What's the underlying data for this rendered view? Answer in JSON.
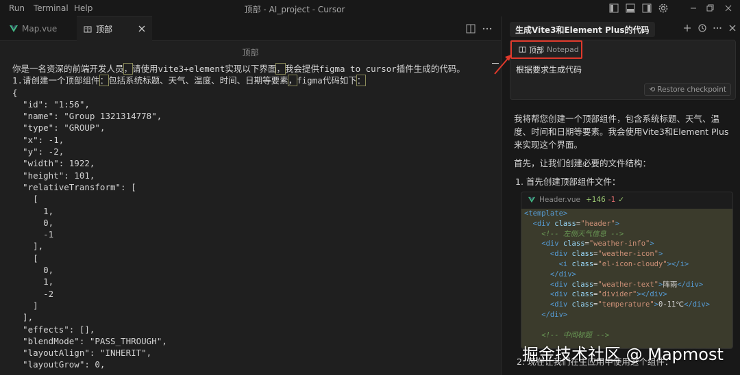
{
  "titlebar": {
    "menus": [
      "Run",
      "Terminal",
      "Help"
    ],
    "title": "顶部 - AI_project - Cursor"
  },
  "editor": {
    "tabs": [
      {
        "label": "Map.vue",
        "icon": "vue-icon",
        "active": false
      },
      {
        "label": "顶部",
        "icon": "notepad-icon",
        "active": true
      }
    ],
    "heading": "顶部",
    "lines": [
      "你是一名资深的前端开发人员，请使用vite3+element实现以下界面，我会提供figma to cursor插件生成的代码。",
      "1.请创建一个顶部组件：包括系统标题、天气、温度、时间、日期等要素，figma代码如下：",
      "{",
      "  \"id\": \"1:56\",",
      "  \"name\": \"Group 1321314778\",",
      "  \"type\": \"GROUP\",",
      "  \"x\": -1,",
      "  \"y\": -2,",
      "  \"width\": 1922,",
      "  \"height\": 101,",
      "  \"relativeTransform\": [",
      "    [",
      "      1,",
      "      0,",
      "      -1",
      "    ],",
      "    [",
      "      0,",
      "      1,",
      "      -2",
      "    ]",
      "  ],",
      "  \"effects\": [],",
      "  \"blendMode\": \"PASS_THROUGH\",",
      "  \"layoutAlign\": \"INHERIT\",",
      "  \"layoutGrow\": 0,"
    ]
  },
  "chat": {
    "title": "生成Vite3和Element Plus的代码",
    "chip_name": "顶部",
    "chip_type": "Notepad",
    "prompt": "根据要求生成代码",
    "restore_label": "Restore checkpoint",
    "reply_p1": "我将帮您创建一个顶部组件，包含系统标题、天气、温度、时间和日期等要素。我会使用Vite3和Element Plus来实现这个界面。",
    "reply_p2": "首先，让我们创建必要的文件结构：",
    "step1": "1. 首先创建顶部组件文件：",
    "card": {
      "filename": "Header.vue",
      "added": "+146",
      "removed": "-1"
    },
    "step2": "2. 现在让我们在主应用中使用这个组件："
  },
  "watermark": "掘金技术社区 @ Mapmost",
  "colors": {
    "highlight_box": "#e0392b",
    "added": "#9fcc74",
    "removed": "#e06c6c"
  }
}
